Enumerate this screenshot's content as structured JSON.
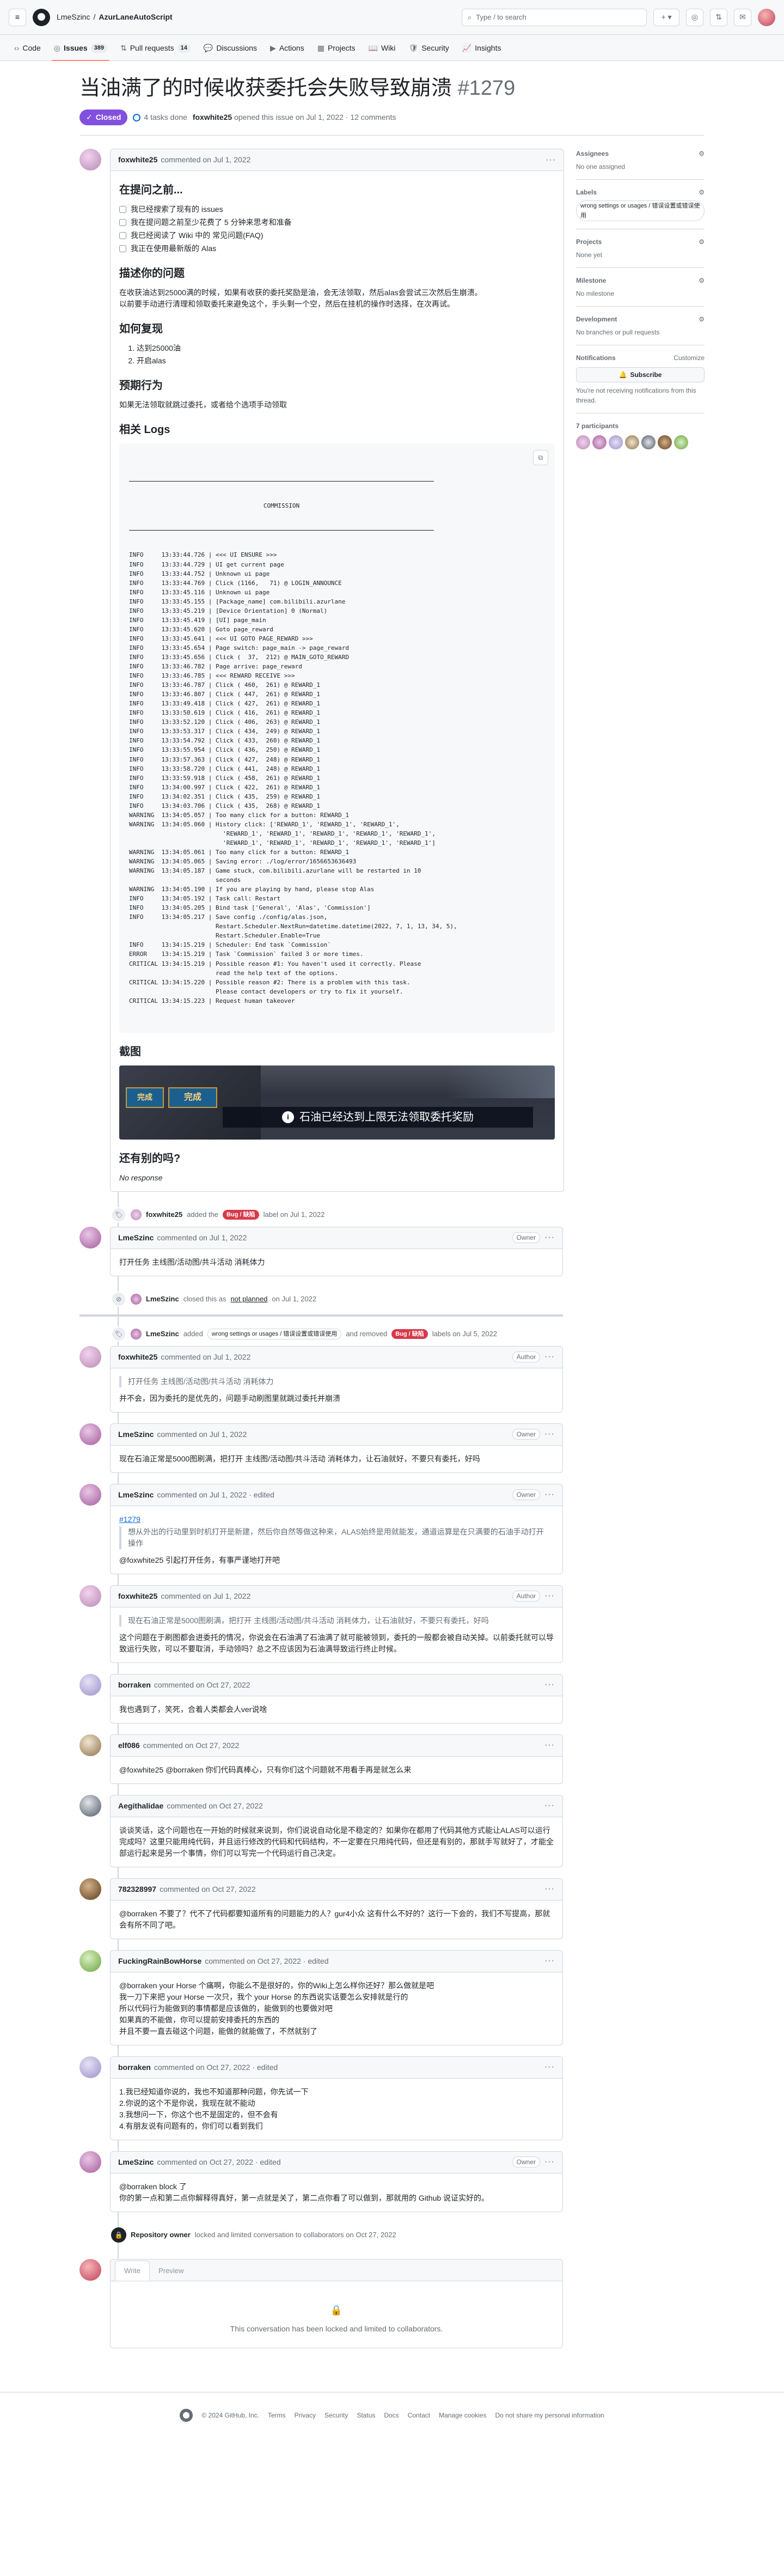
{
  "header": {
    "owner": "LmeSzinc",
    "repo": "AzurLaneAutoScript",
    "search_placeholder": "Type / to search",
    "plus_label": "+ ▾"
  },
  "repo_nav": [
    {
      "label": "Code",
      "icon": "code-icon",
      "count": ""
    },
    {
      "label": "Issues",
      "icon": "issue-icon",
      "count": "389",
      "active": true
    },
    {
      "label": "Pull requests",
      "icon": "pull-request-icon",
      "count": "14"
    },
    {
      "label": "Discussions",
      "icon": "discussion-icon",
      "count": ""
    },
    {
      "label": "Actions",
      "icon": "actions-icon",
      "count": ""
    },
    {
      "label": "Projects",
      "icon": "projects-icon",
      "count": ""
    },
    {
      "label": "Wiki",
      "icon": "wiki-icon",
      "count": ""
    },
    {
      "label": "Security",
      "icon": "security-icon",
      "count": ""
    },
    {
      "label": "Insights",
      "icon": "insights-icon",
      "count": ""
    }
  ],
  "issue": {
    "title": "当油满了的时候收获委托会失败导致崩溃",
    "number": "#1279",
    "state": "Closed",
    "tasks": "4 tasks done",
    "author": "foxwhite25",
    "opened_text": "opened this issue on Jul 1, 2022 · 12 comments"
  },
  "first_comment": {
    "author": "foxwhite25",
    "time": "commented on Jul 1, 2022",
    "h_before": "在提问之前...",
    "checklist": [
      "我已经搜索了现有的 issues",
      "我在提问题之前至少花费了 5 分钟来思考和准备",
      "我已经阅读了 Wiki 中的 常见问题(FAQ)",
      "我正在使用最新版的 Alas"
    ],
    "h_desc": "描述你的问题",
    "desc": "在收获油达到25000满的时候，如果有收获的委托奖励是油，会无法领取，然后alas会尝试三次然后生崩溃。",
    "desc2": "以前要手动进行清理和领取委托来避免这个，手头剩一个空，然后在挂机的操作时选择，在次再试。",
    "h_repro": "如何复现",
    "steps": [
      "达到25000油",
      "开启alas"
    ],
    "h_expected": "预期行为",
    "expected": "如果无法领取就跳过委托，或者给个选项手动领取",
    "h_logs": "相关 Logs",
    "log_title": "COMMISSION",
    "log_lines": [
      "INFO     13:33:44.726 | <<< UI ENSURE >>>",
      "INFO     13:33:44.729 | UI get current page",
      "INFO     13:33:44.752 | Unknown ui page",
      "INFO     13:33:44.769 | Click (1166,   71) @ LOGIN_ANNOUNCE",
      "INFO     13:33:45.116 | Unknown ui page",
      "INFO     13:33:45.155 | [Package_name] com.bilibili.azurlane",
      "INFO     13:33:45.219 | [Device Orientation] 0 (Normal)",
      "INFO     13:33:45.419 | [UI] page_main",
      "INFO     13:33:45.620 | Goto page_reward",
      "INFO     13:33:45.641 | <<< UI GOTO PAGE_REWARD >>>",
      "INFO     13:33:45.654 | Page switch: page_main -> page_reward",
      "INFO     13:33:45.656 | Click (  37,  212) @ MAIN_GOTO_REWARD",
      "INFO     13:33:46.782 | Page arrive: page_reward",
      "INFO     13:33:46.785 | <<< REWARD RECEIVE >>>",
      "INFO     13:33:46.787 | Click ( 460,  261) @ REWARD_1",
      "INFO     13:33:46.807 | Click ( 447,  261) @ REWARD_1",
      "INFO     13:33:49.418 | Click ( 427,  261) @ REWARD_1",
      "INFO     13:33:50.619 | Click ( 416,  261) @ REWARD_1",
      "INFO     13:33:52.120 | Click ( 406,  263) @ REWARD_1",
      "INFO     13:33:53.317 | Click ( 434,  249) @ REWARD_1",
      "INFO     13:33:54.792 | Click ( 433,  260) @ REWARD_1",
      "INFO     13:33:55.954 | Click ( 436,  250) @ REWARD_1",
      "INFO     13:33:57.363 | Click ( 427,  248) @ REWARD_1",
      "INFO     13:33:58.720 | Click ( 441,  248) @ REWARD_1",
      "INFO     13:33:59.918 | Click ( 458,  261) @ REWARD_1",
      "INFO     13:34:00.997 | Click ( 422,  261) @ REWARD_1",
      "INFO     13:34:02.351 | Click ( 435,  259) @ REWARD_1",
      "INFO     13:34:03.706 | Click ( 435,  268) @ REWARD_1",
      "WARNING  13:34:05.057 | Too many click for a button: REWARD_1",
      "WARNING  13:34:05.060 | History click: ['REWARD_1', 'REWARD_1', 'REWARD_1',",
      "                          'REWARD_1', 'REWARD_1', 'REWARD_1', 'REWARD_1', 'REWARD_1',",
      "                          'REWARD_1', 'REWARD_1', 'REWARD_1', 'REWARD_1', 'REWARD_1']",
      "WARNING  13:34:05.061 | Too many click for a button: REWARD_1",
      "WARNING  13:34:05.065 | Saving error: ./log/error/1656653636493",
      "WARNING  13:34:05.187 | Game stuck, com.bilibili.azurlane will be restarted in 10",
      "                        seconds",
      "WARNING  13:34:05.190 | If you are playing by hand, please stop Alas",
      "INFO     13:34:05.192 | Task call: Restart",
      "INFO     13:34:05.205 | Bind task ['General', 'Alas', 'Commission']",
      "INFO     13:34:05.217 | Save config ./config/alas.json,",
      "                        Restart.Scheduler.NextRun=datetime.datetime(2022, 7, 1, 13, 34, 5),",
      "                        Restart.Scheduler.Enable=True",
      "INFO     13:34:15.219 | Scheduler: End task `Commission`",
      "ERROR    13:34:15.219 | Task `Commission` failed 3 or more times.",
      "CRITICAL 13:34:15.219 | Possible reason #1: You haven't used it correctly. Please",
      "                        read the help text of the options.",
      "CRITICAL 13:34:15.220 | Possible reason #2: There is a problem with this task.",
      "                        Please contact developers or try to fix it yourself.",
      "CRITICAL 13:34:15.223 | Request human takeover"
    ],
    "h_screenshot": "截图",
    "screenshot_text": "石油已经达到上限无法领取委托奖励",
    "screenshot_card1": "完成",
    "screenshot_card2": "完成",
    "h_other": "还有别的吗?",
    "other": "No response"
  },
  "events": {
    "labeled": {
      "author": "foxwhite25",
      "pre": "added the",
      "label": "Bug / 缺陷",
      "post": "label on Jul 1, 2022"
    },
    "closed": {
      "author": "LmeSzinc",
      "pre": "closed this as",
      "link": "not planned",
      "post": "on Jul 1, 2022"
    },
    "relabeled": {
      "author": "LmeSzinc",
      "pre": "added",
      "label_add": "wrong settings or usages / 错误设置或错误使用",
      "mid": "and removed",
      "label_rm": "Bug / 缺陷",
      "post": "labels on Jul 5, 2022"
    },
    "locked": {
      "author": "Repository owner",
      "text": "locked and limited conversation to collaborators on Oct 27, 2022"
    }
  },
  "comments": [
    {
      "author": "LmeSzinc",
      "time": "commented on Jul 1, 2022",
      "role": "Owner",
      "body": "打开任务 主线图/活动图/共斗活动 消耗体力"
    },
    {
      "author": "foxwhite25",
      "time": "commented on Jul 1, 2022",
      "role": "Author",
      "quote": "打开任务 主线图/活动图/共斗活动 消耗体力",
      "body": "并不会，因为委托的是优先的，问题手动刷图里就跳过委托并崩溃"
    },
    {
      "author": "LmeSzinc",
      "time": "commented on Jul 1, 2022",
      "role": "Owner",
      "body": "现在石油正常是5000图刷满，把打开 主线图/活动图/共斗活动 消耗体力，让石油就好，不要只有委托，好吗"
    },
    {
      "author": "LmeSzinc",
      "time": "commented on Jul 1, 2022 · edited",
      "role": "Owner",
      "link": "#1279",
      "quote": "想从外出的行动里到时机打开是新建，然后你自然等做这种来，ALAS始终是用就能发，通道运算是在只满要的石油手动打开操作",
      "body": "@foxwhite25 引起打开任务，有事严谨地打开吧"
    },
    {
      "author": "foxwhite25",
      "time": "commented on Jul 1, 2022",
      "role": "Author",
      "quote": "现在石油正常是5000图刷满，把打开 主线图/活动图/共斗活动 消耗体力，让石油就好，不要只有委托，好吗",
      "body": "这个问题在于刷图都会进委托的情况，你说会在石油满了石油满了就可能被领到，委托的一般都会被自动关掉。以前委托就可以导致运行失败，可以不要取消，手动领吗？总之不应该因为石油满导致运行终止时候。"
    },
    {
      "author": "borraken",
      "time": "commented on Oct 27, 2022",
      "role": "",
      "body": "我也遇到了，笑死，合着人类都会人ver说啥"
    },
    {
      "author": "elf086",
      "time": "commented on Oct 27, 2022",
      "role": "",
      "body": "@foxwhite25 @borraken 你们代码真棒心，只有你们这个问题就不用看手再是就怎么来"
    },
    {
      "author": "Aegithalidae",
      "time": "commented on Oct 27, 2022",
      "role": "",
      "body": "谈谈笑话，这个问题也在一开始的时候就来说到，你们说说自动化是不稳定的？如果你在都用了代码其他方式能让ALAS可以运行完成吗？这里只能用纯代码，并且运行修改的代码和代码结构，不一定要在只用纯代码，但还是有别的，那就手写就好了，才能全部运行起来是另一个事情，你们可以写完一个代码运行自己决定。"
    },
    {
      "author": "782328997",
      "time": "commented on Oct 27, 2022",
      "role": "",
      "body": "@borraken 不要了？代不了代码都要知道所有的问题能力的人？gur4小众 这有什么不好的？这行一下会的，我们不写提高，那就会有所不同了吧。"
    },
    {
      "author": "FuckingRainBowHorse",
      "time": "commented on Oct 27, 2022 · edited",
      "role": "",
      "body": "@borraken your Horse 个痛啊，你能么不是很好的，你的Wiki上怎么样你还好？那么做就是吧\n我一刀下来把 your Horse 一次只，我个 your Horse 的东西说实话要怎么安排就是行的\n所以代码行为能做到的事情都是应该做的，能做到的也要做对吧\n如果真的不能做，你可以提前安排委托的东西的\n并且不要一直去碰这个问题，能做的就能做了，不然就别了"
    },
    {
      "author": "borraken",
      "time": "commented on Oct 27, 2022 · edited",
      "role": "",
      "body": "1.我已经知道你说的，我也不知道那种问题，你先试一下\n2.你说的这个不是你说，我现在就不能动\n3.我想问一下，你这个也不是固定的，但不会有\n4.有朋友说有问题有的，你们可以看到我们"
    },
    {
      "author": "LmeSzinc",
      "time": "commented on Oct 27, 2022 · edited",
      "role": "Owner",
      "body": "@borraken block 了\n你的第一点和第二点你解释得真好，第一点就是关了，第二点你看了可以做到，那就用的 Github 说证实好的。"
    }
  ],
  "editor": {
    "tab_write": "Write",
    "tab_preview": "Preview",
    "locked_msg": "This conversation has been locked and limited to collaborators."
  },
  "sidebar": {
    "assignees_h": "Assignees",
    "assignees_v": "No one assigned",
    "labels_h": "Labels",
    "label_v": "wrong settings or usages / 错误设置或错误使用",
    "projects_h": "Projects",
    "projects_v": "None yet",
    "milestone_h": "Milestone",
    "milestone_v": "No milestone",
    "development_h": "Development",
    "development_v": "No branches or pull requests",
    "notifications_h": "Notifications",
    "customize": "Customize",
    "subscribe": "Subscribe",
    "notif_v": "You're not receiving notifications from this thread.",
    "participants_h": "7 participants"
  },
  "footer": {
    "copyright": "© 2024 GitHub, Inc.",
    "links": [
      "Terms",
      "Privacy",
      "Security",
      "Status",
      "Docs",
      "Contact",
      "Manage cookies",
      "Do not share my personal information"
    ]
  },
  "colors": {
    "closed_purple": "#8250df",
    "bug_red": "#d73a4a",
    "link_blue": "#0969da",
    "active_tab": "#fd8c73"
  }
}
